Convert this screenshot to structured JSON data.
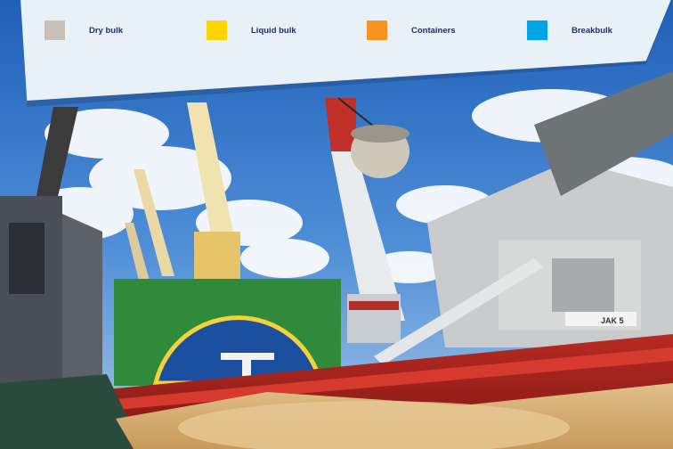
{
  "legend": {
    "items": [
      {
        "label": "Dry bulk",
        "color": "#c8bfb6"
      },
      {
        "label": "Liquid bulk",
        "color": "#ffd400"
      },
      {
        "label": "Containers",
        "color": "#f7931e"
      },
      {
        "label": "Breakbulk",
        "color": "#00a5e5"
      }
    ]
  },
  "photo": {
    "subject": "cargo ship being loaded with dry bulk grain by port cranes",
    "hull_marking": "JAK 5"
  }
}
